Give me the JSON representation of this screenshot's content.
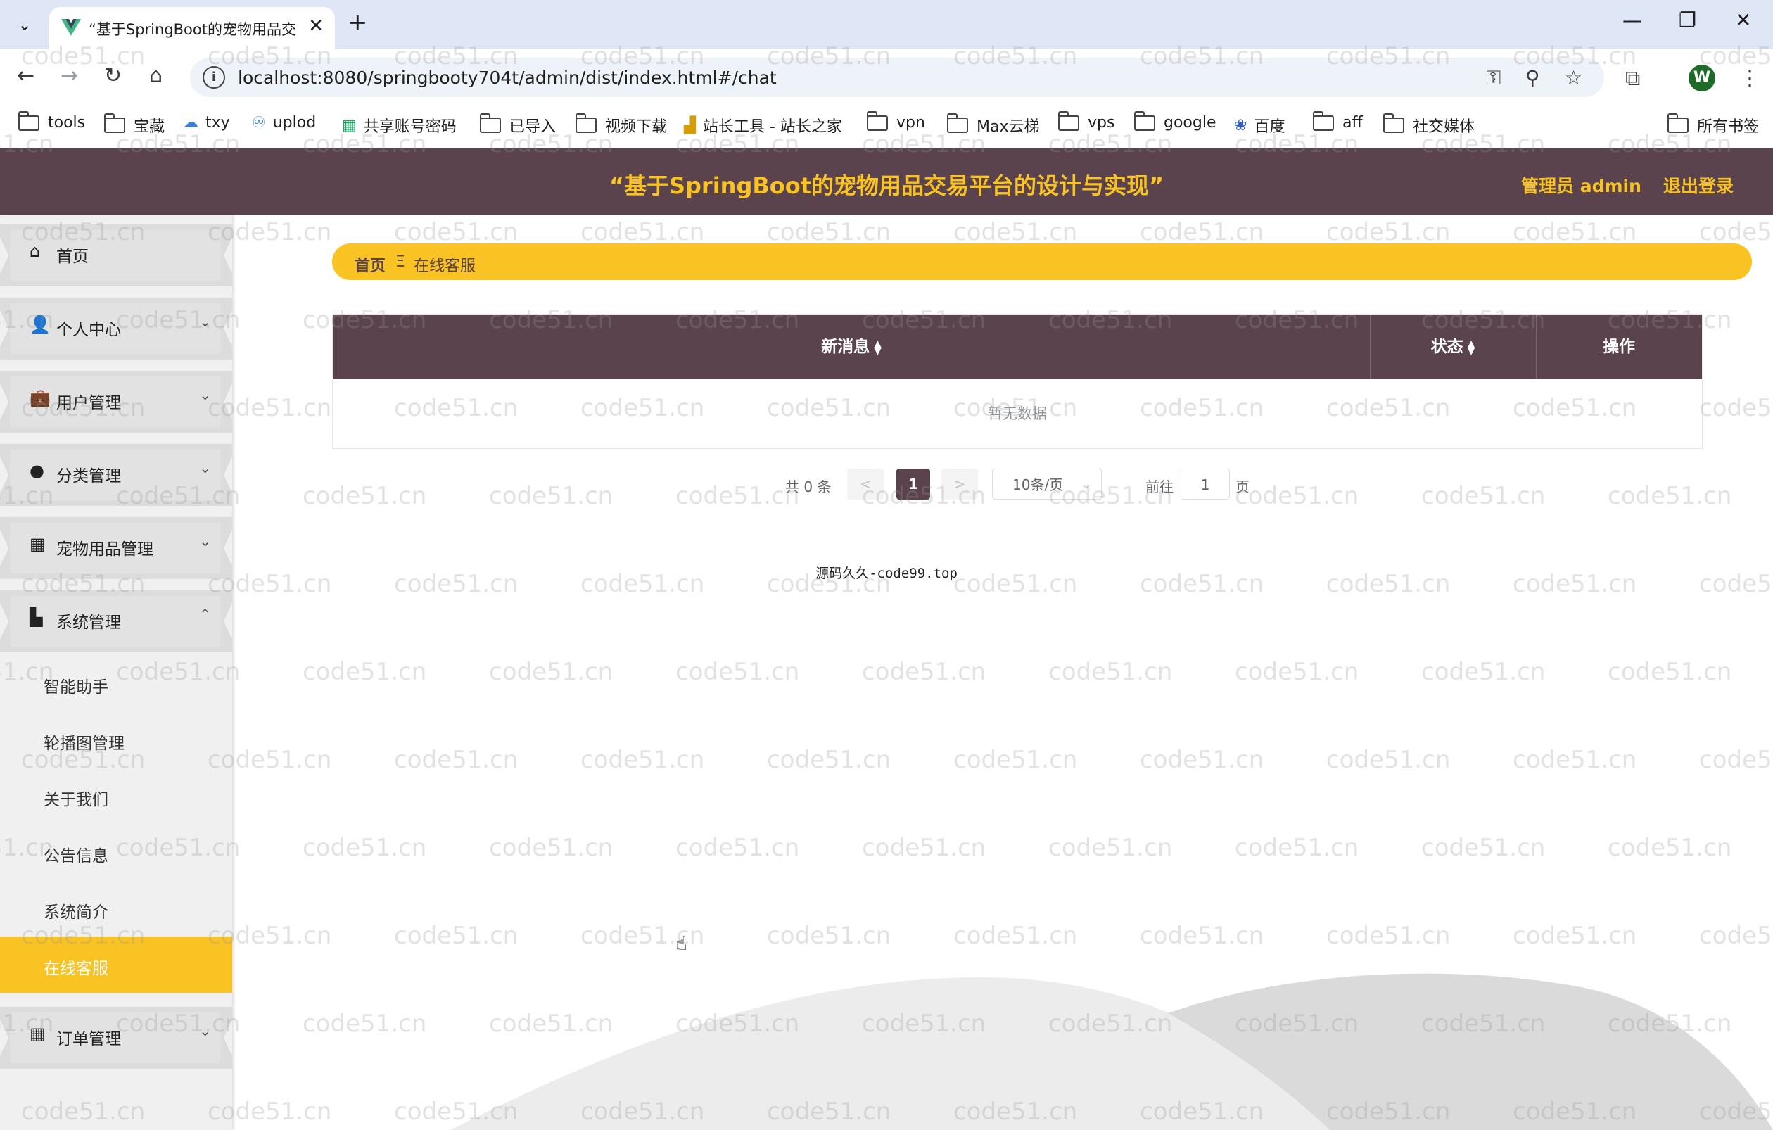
{
  "browser": {
    "tab_title": "“基于SpringBoot的宠物用品交",
    "url": "localhost:8080/springbooty704t/admin/dist/index.html#/chat",
    "profile_initial": "W",
    "bookmarks": [
      "tools",
      "宝藏",
      "txy",
      "uplod",
      "共享账号密码",
      "已导入",
      "视频下载",
      "站长工具 - 站长之家",
      "vpn",
      "Max云梯",
      "vps",
      "google",
      "百度",
      "aff",
      "社交媒体"
    ],
    "all_bookmarks": "所有书签"
  },
  "header": {
    "title": "“基于SpringBoot的宠物用品交易平台的设计与实现”",
    "admin_label": "管理员 admin",
    "logout_label": "退出登录"
  },
  "sidebar": {
    "items": [
      {
        "label": "首页",
        "icon": "home-icon"
      },
      {
        "label": "个人中心",
        "icon": "user-icon"
      },
      {
        "label": "用户管理",
        "icon": "briefcase-icon"
      },
      {
        "label": "分类管理",
        "icon": "bulb-icon"
      },
      {
        "label": "宠物用品管理",
        "icon": "grid-icon"
      },
      {
        "label": "系统管理",
        "icon": "book-icon"
      },
      {
        "label": "订单管理",
        "icon": "grid-icon"
      }
    ],
    "sub_items": [
      "智能助手",
      "轮播图管理",
      "关于我们",
      "公告信息",
      "系统简介",
      "在线客服"
    ]
  },
  "breadcrumb": {
    "home": "首页",
    "separator": "Ξ",
    "current": "在线客服"
  },
  "table": {
    "columns": [
      "新消息",
      "状态",
      "操作"
    ],
    "empty_text": "暂无数据"
  },
  "pagination": {
    "total": "共 0 条",
    "prev": "<",
    "page": "1",
    "next": ">",
    "page_size": "10条/页",
    "goto_prefix": "前往",
    "goto_value": "1",
    "goto_suffix": "页"
  },
  "footer_note": "源码久久-code99.top",
  "watermark": "code51.cn",
  "colors": {
    "header": "#5b434d",
    "accent": "#f8c323"
  }
}
